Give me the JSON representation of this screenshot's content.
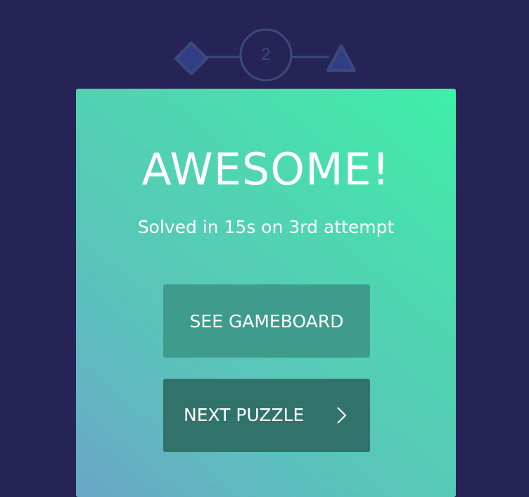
{
  "progress": {
    "current_step": "2",
    "steps": [
      "diamond-icon",
      "2",
      "triangle-icon"
    ],
    "colors": {
      "shape_fill": "#333d86",
      "shape_stroke": "#3a4a7d",
      "line": "#3a4a7d"
    }
  },
  "result": {
    "headline": "AWESOME!",
    "subtitle": "Solved in 15s on 3rd attempt"
  },
  "actions": {
    "see_gameboard_label": "SEE GAMEBOARD",
    "next_puzzle_label": "NEXT PUZZLE",
    "next_icon": "chevron-right-icon"
  },
  "colors": {
    "background": "#262456",
    "card_gradient": [
      "#3fefa9",
      "#6aa6c6"
    ],
    "button_primary": "#3f9c8d",
    "button_dark": "#31736a",
    "text": "#ffffff"
  }
}
